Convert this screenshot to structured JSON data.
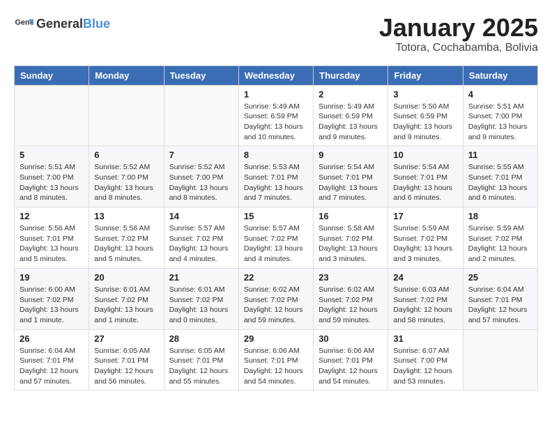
{
  "header": {
    "logo_general": "General",
    "logo_blue": "Blue",
    "month": "January 2025",
    "location": "Totora, Cochabamba, Bolivia"
  },
  "weekdays": [
    "Sunday",
    "Monday",
    "Tuesday",
    "Wednesday",
    "Thursday",
    "Friday",
    "Saturday"
  ],
  "weeks": [
    [
      {
        "day": "",
        "info": ""
      },
      {
        "day": "",
        "info": ""
      },
      {
        "day": "",
        "info": ""
      },
      {
        "day": "1",
        "info": "Sunrise: 5:49 AM\nSunset: 6:59 PM\nDaylight: 13 hours\nand 10 minutes."
      },
      {
        "day": "2",
        "info": "Sunrise: 5:49 AM\nSunset: 6:59 PM\nDaylight: 13 hours\nand 9 minutes."
      },
      {
        "day": "3",
        "info": "Sunrise: 5:50 AM\nSunset: 6:59 PM\nDaylight: 13 hours\nand 9 minutes."
      },
      {
        "day": "4",
        "info": "Sunrise: 5:51 AM\nSunset: 7:00 PM\nDaylight: 13 hours\nand 9 minutes."
      }
    ],
    [
      {
        "day": "5",
        "info": "Sunrise: 5:51 AM\nSunset: 7:00 PM\nDaylight: 13 hours\nand 8 minutes."
      },
      {
        "day": "6",
        "info": "Sunrise: 5:52 AM\nSunset: 7:00 PM\nDaylight: 13 hours\nand 8 minutes."
      },
      {
        "day": "7",
        "info": "Sunrise: 5:52 AM\nSunset: 7:00 PM\nDaylight: 13 hours\nand 8 minutes."
      },
      {
        "day": "8",
        "info": "Sunrise: 5:53 AM\nSunset: 7:01 PM\nDaylight: 13 hours\nand 7 minutes."
      },
      {
        "day": "9",
        "info": "Sunrise: 5:54 AM\nSunset: 7:01 PM\nDaylight: 13 hours\nand 7 minutes."
      },
      {
        "day": "10",
        "info": "Sunrise: 5:54 AM\nSunset: 7:01 PM\nDaylight: 13 hours\nand 6 minutes."
      },
      {
        "day": "11",
        "info": "Sunrise: 5:55 AM\nSunset: 7:01 PM\nDaylight: 13 hours\nand 6 minutes."
      }
    ],
    [
      {
        "day": "12",
        "info": "Sunrise: 5:56 AM\nSunset: 7:01 PM\nDaylight: 13 hours\nand 5 minutes."
      },
      {
        "day": "13",
        "info": "Sunrise: 5:56 AM\nSunset: 7:02 PM\nDaylight: 13 hours\nand 5 minutes."
      },
      {
        "day": "14",
        "info": "Sunrise: 5:57 AM\nSunset: 7:02 PM\nDaylight: 13 hours\nand 4 minutes."
      },
      {
        "day": "15",
        "info": "Sunrise: 5:57 AM\nSunset: 7:02 PM\nDaylight: 13 hours\nand 4 minutes."
      },
      {
        "day": "16",
        "info": "Sunrise: 5:58 AM\nSunset: 7:02 PM\nDaylight: 13 hours\nand 3 minutes."
      },
      {
        "day": "17",
        "info": "Sunrise: 5:59 AM\nSunset: 7:02 PM\nDaylight: 13 hours\nand 3 minutes."
      },
      {
        "day": "18",
        "info": "Sunrise: 5:59 AM\nSunset: 7:02 PM\nDaylight: 13 hours\nand 2 minutes."
      }
    ],
    [
      {
        "day": "19",
        "info": "Sunrise: 6:00 AM\nSunset: 7:02 PM\nDaylight: 13 hours\nand 1 minute."
      },
      {
        "day": "20",
        "info": "Sunrise: 6:01 AM\nSunset: 7:02 PM\nDaylight: 13 hours\nand 1 minute."
      },
      {
        "day": "21",
        "info": "Sunrise: 6:01 AM\nSunset: 7:02 PM\nDaylight: 13 hours\nand 0 minutes."
      },
      {
        "day": "22",
        "info": "Sunrise: 6:02 AM\nSunset: 7:02 PM\nDaylight: 12 hours\nand 59 minutes."
      },
      {
        "day": "23",
        "info": "Sunrise: 6:02 AM\nSunset: 7:02 PM\nDaylight: 12 hours\nand 59 minutes."
      },
      {
        "day": "24",
        "info": "Sunrise: 6:03 AM\nSunset: 7:02 PM\nDaylight: 12 hours\nand 58 minutes."
      },
      {
        "day": "25",
        "info": "Sunrise: 6:04 AM\nSunset: 7:01 PM\nDaylight: 12 hours\nand 57 minutes."
      }
    ],
    [
      {
        "day": "26",
        "info": "Sunrise: 6:04 AM\nSunset: 7:01 PM\nDaylight: 12 hours\nand 57 minutes."
      },
      {
        "day": "27",
        "info": "Sunrise: 6:05 AM\nSunset: 7:01 PM\nDaylight: 12 hours\nand 56 minutes."
      },
      {
        "day": "28",
        "info": "Sunrise: 6:05 AM\nSunset: 7:01 PM\nDaylight: 12 hours\nand 55 minutes."
      },
      {
        "day": "29",
        "info": "Sunrise: 6:06 AM\nSunset: 7:01 PM\nDaylight: 12 hours\nand 54 minutes."
      },
      {
        "day": "30",
        "info": "Sunrise: 6:06 AM\nSunset: 7:01 PM\nDaylight: 12 hours\nand 54 minutes."
      },
      {
        "day": "31",
        "info": "Sunrise: 6:07 AM\nSunset: 7:00 PM\nDaylight: 12 hours\nand 53 minutes."
      },
      {
        "day": "",
        "info": ""
      }
    ]
  ]
}
